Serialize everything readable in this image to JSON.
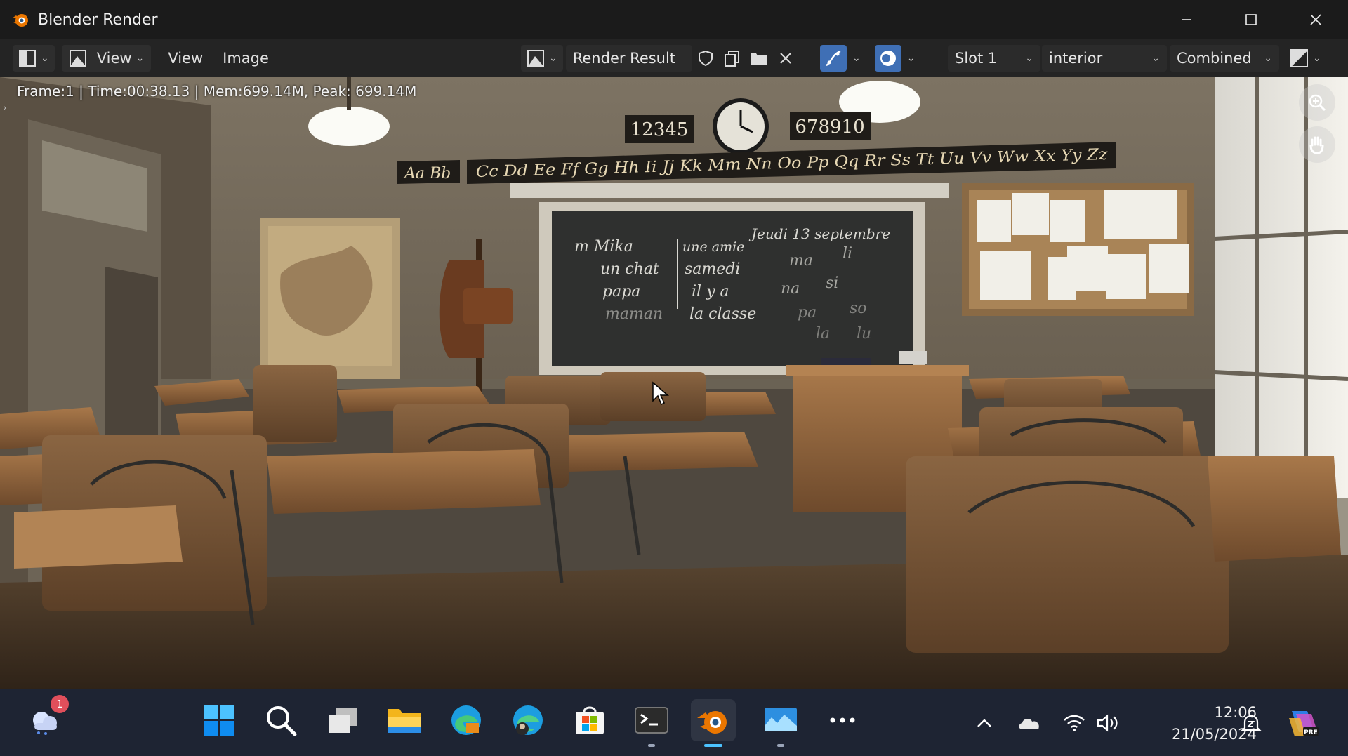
{
  "window": {
    "title": "Blender Render"
  },
  "header": {
    "view_dropdown": "View",
    "menu_view": "View",
    "menu_image": "Image",
    "image_name": "Render Result",
    "slot": "Slot 1",
    "view_layer": "interior",
    "pass": "Combined"
  },
  "viewport": {
    "stats": "Frame:1 | Time:00:38.13 | Mem:699.14M, Peak: 699.14M",
    "clock_left_numbers": "12345",
    "clock_right_numbers": "678910",
    "alphabet_left": "Aa Bb",
    "alphabet_right": "Cc Dd Ee Ff Gg Hh Ii Jj Kk Mm Nn Oo Pp Qq Rr Ss Tt Uu Vv Ww Xx Yy Zz",
    "chalk_date": "Jeudi 13 septembre",
    "chalk_col1": [
      "m Mika",
      "un chat",
      "papa",
      "maman"
    ],
    "chalk_col2": [
      "une amie",
      "samedi",
      "il y a",
      "la classe"
    ],
    "chalk_col3": [
      "ma",
      "li",
      "na",
      "si",
      "pa",
      "so",
      "la",
      "lu"
    ]
  },
  "taskbar": {
    "notification_count": "1",
    "time": "12:06",
    "date": "21/05/2024"
  },
  "colors": {
    "blender_orange": "#ea7600",
    "header_bg": "#242424",
    "highlight_blue": "#3f6fb5",
    "taskbar_bg": "#1e2433"
  }
}
